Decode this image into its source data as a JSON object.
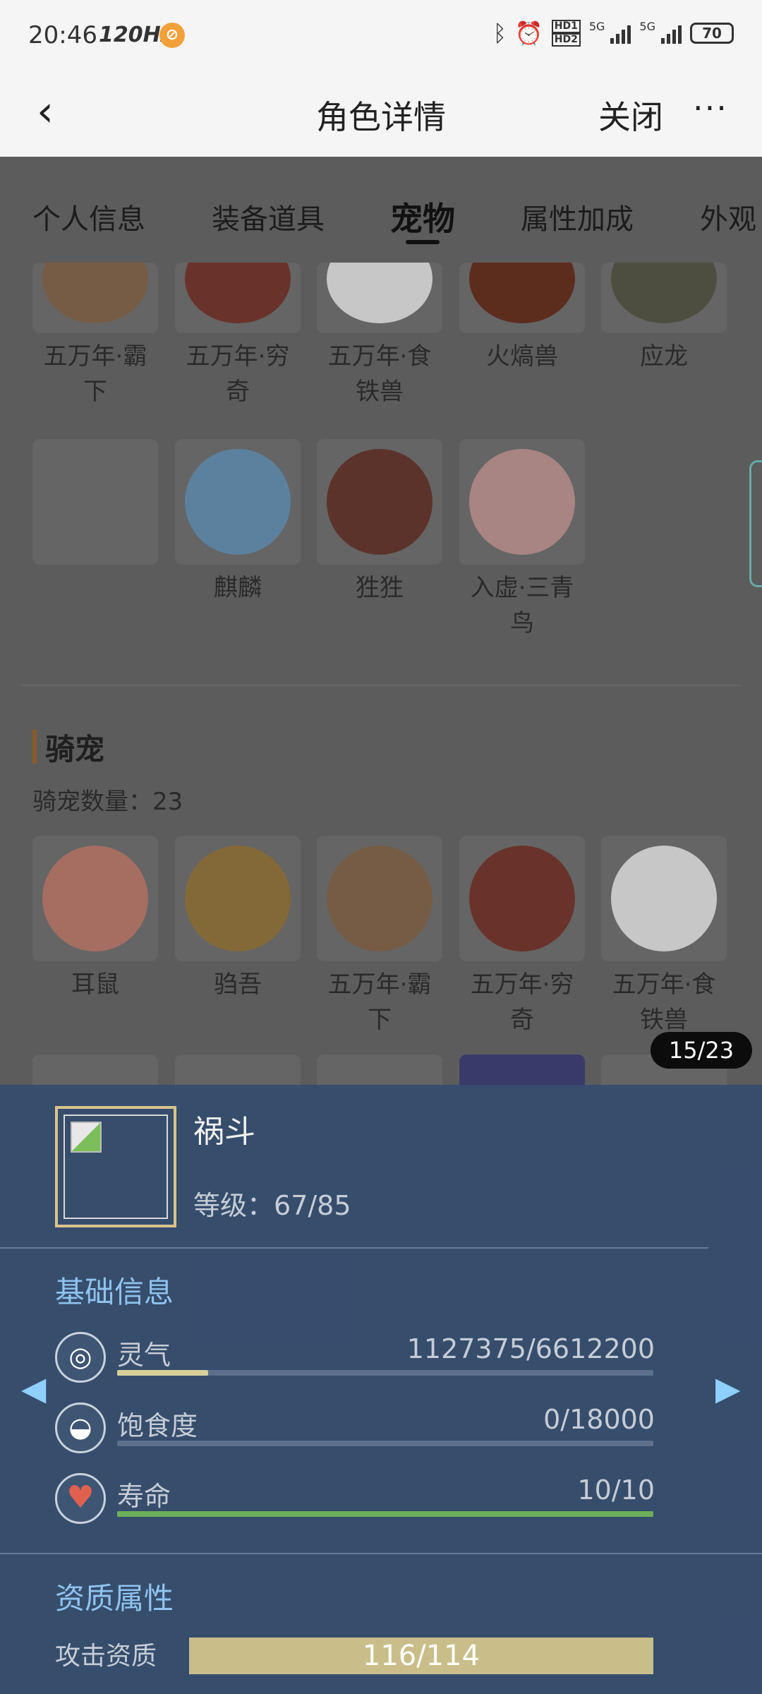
{
  "status": {
    "time": "20:46",
    "refresh": "120HZ",
    "hd1": "HD1",
    "hd2": "HD2",
    "net1": "5G",
    "net2": "5G",
    "battery": "70"
  },
  "nav": {
    "title": "角色详情",
    "close_label": "关闭",
    "more_label": "···"
  },
  "tabs": [
    "个人信息",
    "装备道具",
    "宠物",
    "属性加成",
    "外观"
  ],
  "active_tab": "宠物",
  "pets_top_row": [
    {
      "name": "五万年·霸下",
      "color": "#7a5a40"
    },
    {
      "name": "五万年·穷奇",
      "color": "#6a2a22"
    },
    {
      "name": "五万年·食铁兽",
      "color": "#d8d8d8"
    },
    {
      "name": "火熇兽",
      "color": "#5a2210"
    },
    {
      "name": "应龙",
      "color": "#4a4a3a"
    }
  ],
  "pets_second_row": [
    {
      "name": "",
      "color": "#656565"
    },
    {
      "name": "麒麟",
      "color": "#5a86a8"
    },
    {
      "name": "狌狌",
      "color": "#5a2a20"
    },
    {
      "name": "入虚·三青鸟",
      "color": "#b48a88"
    }
  ],
  "mounts_section": {
    "title": "骑宠",
    "count_label": "骑宠数量：",
    "count_value": "23"
  },
  "mounts_row": [
    {
      "name": "耳鼠",
      "color": "#b07060"
    },
    {
      "name": "驺吾",
      "color": "#8a6a30"
    },
    {
      "name": "五万年·霸下",
      "color": "#7a5a40"
    },
    {
      "name": "五万年·穷奇",
      "color": "#6a2a22"
    },
    {
      "name": "五万年·食铁兽",
      "color": "#d8d8d8"
    }
  ],
  "pager": "15/23",
  "detail": {
    "name": "祸斗",
    "level_label": "等级：",
    "level_value": "67/85",
    "basic_heading": "基础信息",
    "stats": [
      {
        "label": "灵气",
        "value": "1127375/6612200",
        "fill": 0.17,
        "color": "#d8cf9a",
        "icon": "swirl-icon",
        "glyph": "◎"
      },
      {
        "label": "饱食度",
        "value": "0/18000",
        "fill": 0.0,
        "color": "#d8cf9a",
        "icon": "stomach-icon",
        "glyph": "◒"
      },
      {
        "label": "寿命",
        "value": "10/10",
        "fill": 1.0,
        "color": "#6fae5a",
        "icon": "heart-icon",
        "glyph": "♥"
      }
    ],
    "aptitude_heading": "资质属性",
    "aptitude": {
      "label": "攻击资质",
      "value": "116/114"
    }
  },
  "arrows": {
    "left": "◀",
    "right": "▶"
  }
}
